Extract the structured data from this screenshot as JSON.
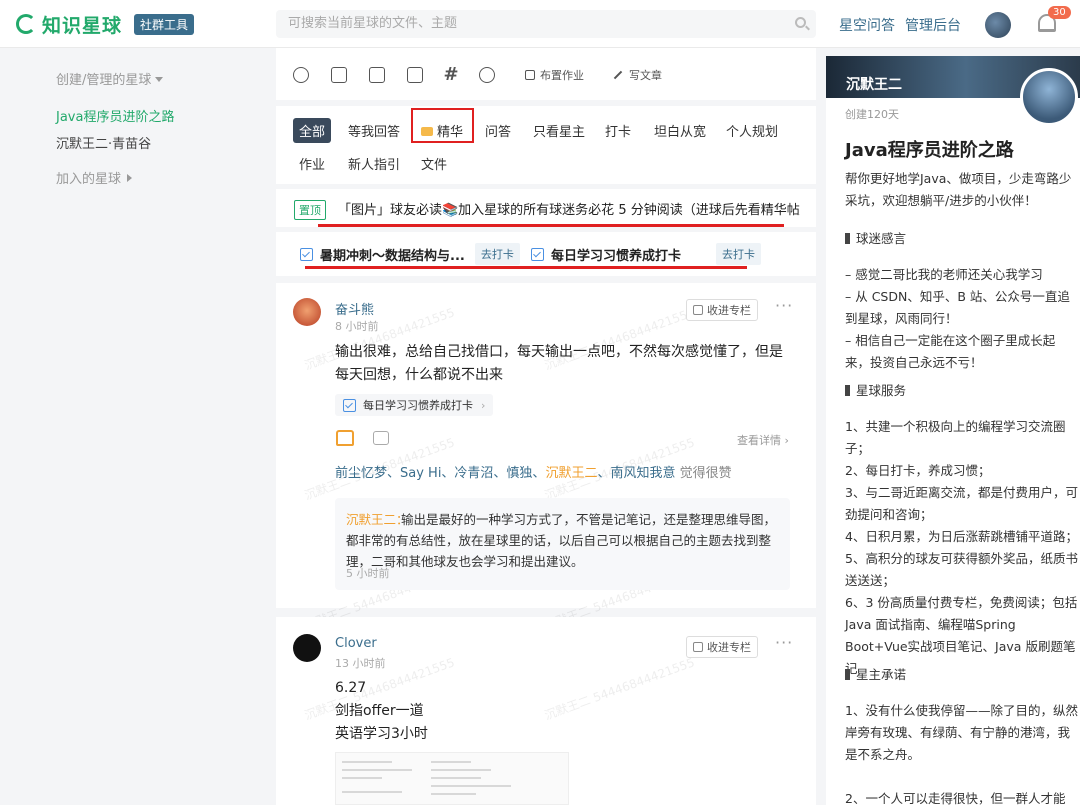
{
  "header": {
    "logo_text": "知识星球",
    "logo_badge": "社群工具",
    "search_placeholder": "可搜索当前星球的文件、主题",
    "nav": [
      "星空问答",
      "管理后台"
    ],
    "notification_count": "30"
  },
  "sidebar": {
    "created_heading": "创建/管理的星球",
    "items": [
      "Java程序员进阶之路",
      "沉默王二·青苗谷"
    ],
    "joined_heading": "加入的星球"
  },
  "toolbar": {
    "homework_label": "布置作业",
    "article_label": "写文章"
  },
  "filters": [
    "全部",
    "等我回答",
    "精华",
    "问答",
    "只看星主",
    "打卡",
    "坦白从宽",
    "个人规划",
    "作业",
    "新人指引",
    "文件"
  ],
  "pinned": {
    "tag": "置顶",
    "text": "「图片」球友必读📚加入星球的所有球迷务必花 5 分钟阅读（进球后先看精华帖/..."
  },
  "tasks": [
    {
      "title": "暑期冲刺～数据结构与...",
      "action": "去打卡"
    },
    {
      "title": "每日学习习惯养成打卡",
      "action": "去打卡"
    }
  ],
  "posts": [
    {
      "author": "奋斗熊",
      "time": "8 小时前",
      "collect": "收进专栏",
      "body": "输出很难，总给自己找借口，每天输出一点吧，不然每次感觉懂了，但是每天回想，什么都说不出来",
      "tag": "每日学习习惯养成打卡",
      "view_detail": "查看详情",
      "likers": "前尘忆梦、Say Hi、冷青沼、慎独、",
      "likers_highlight": "沉默王二",
      "likers_tail": "、南风知我意",
      "likes_suffix": " 觉得很赞",
      "comment": {
        "author": "沉默王二：",
        "text": "输出是最好的一种学习方式了，不管是记笔记，还是整理思维导图，都非常的有总结性，放在星球里的话，以后自己可以根据自己的主题去找到整理，二哥和其他球友也会学习和提出建议。",
        "time": "5 小时前"
      }
    },
    {
      "author": "Clover",
      "time": "13 小时前",
      "collect": "收进专栏",
      "lines": [
        "6.27",
        "剑指offer一道",
        "英语学习3小时"
      ]
    }
  ],
  "right": {
    "owner": "沉默王二",
    "created": "创建120天",
    "title": "Java程序员进阶之路",
    "intro": "帮你更好地学Java、做项目，少走弯路少采坑，欢迎想躺平/进步的小伙伴！",
    "sections": [
      {
        "head": "球迷感言",
        "body": "– 感觉二哥比我的老师还关心我学习\n– 从 CSDN、知乎、B 站、公众号一直追到星球，风雨同行！\n– 相信自己一定能在这个圈子里成长起来，投资自己永远不亏！"
      },
      {
        "head": "星球服务",
        "body": "1、共建一个积极向上的编程学习交流圈子；\n2、每日打卡，养成习惯；\n3、与二哥近距离交流，都是付费用户，可劲提问和咨询；\n4、日积月累，为日后涨薪跳槽铺平道路；\n5、高积分的球友可获得额外奖品，纸质书送送送；\n6、3 份高质量付费专栏，免费阅读；包括Java 面试指南、编程喵Spring Boot+Vue实战项目笔记、Java 版刷题笔记"
      },
      {
        "head": "星主承诺",
        "body": "1、没有什么使我停留——除了目的，纵然岸旁有玫瑰、有绿荫、有宁静的港湾，我是不系之舟。\n\n2、一个人可以走得很快，但一群人才能"
      }
    ]
  },
  "colors": {
    "brand": "#22a96b",
    "link": "#3a6d8c",
    "highlight": "#f0a030",
    "annotation": "#e02020"
  }
}
